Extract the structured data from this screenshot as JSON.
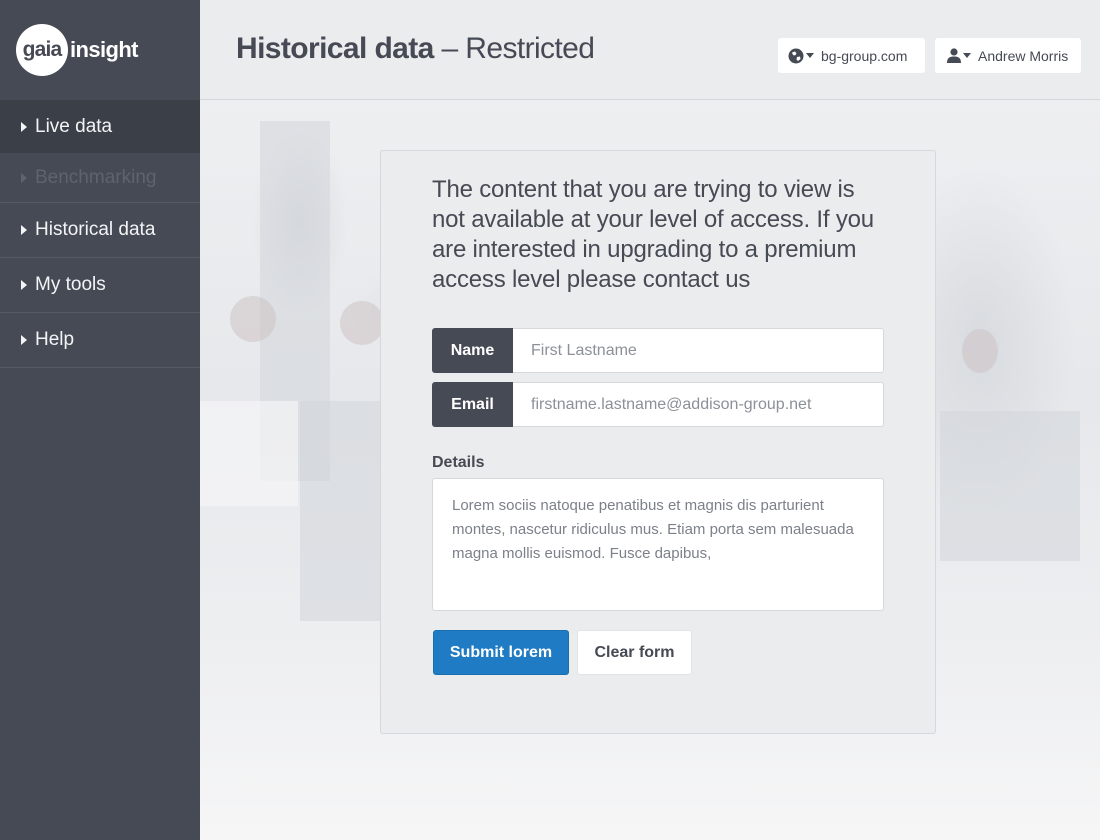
{
  "app": {
    "logo_mark": "gaia",
    "logo_word": "insight"
  },
  "sidebar": {
    "items": [
      {
        "label": "Live data",
        "state": "active"
      },
      {
        "label": "Benchmarking",
        "state": "disabled"
      },
      {
        "label": "Historical data",
        "state": "normal"
      },
      {
        "label": "My tools",
        "state": "normal"
      },
      {
        "label": "Help",
        "state": "normal"
      }
    ]
  },
  "header": {
    "title_strong": "Historical data",
    "title_light": " – Restricted",
    "domain_label": "bg-group.com",
    "domain_icon": "globe-icon",
    "user_label": "Andrew Morris",
    "user_icon": "user-icon"
  },
  "panel": {
    "message": "The content that you are trying to view is not available at your level of access. If you are interested in upgrading to a premium access level please contact us",
    "name_label": "Name",
    "name_placeholder": "First Lastname",
    "email_label": "Email",
    "email_placeholder": "firstname.lastname@addison-group.net",
    "details_label": "Details",
    "details_value": "Lorem sociis natoque penatibus et magnis dis parturient montes, nascetur ridiculus mus. Etiam porta sem malesuada magna mollis euismod. Fusce dapibus,",
    "submit_label": "Submit lorem",
    "clear_label": "Clear form"
  },
  "colors": {
    "sidebar_bg": "#464a54",
    "sidebar_active_bg": "#3b3f47",
    "accent": "#1f7bc4",
    "page_bg": "#ebecee"
  }
}
